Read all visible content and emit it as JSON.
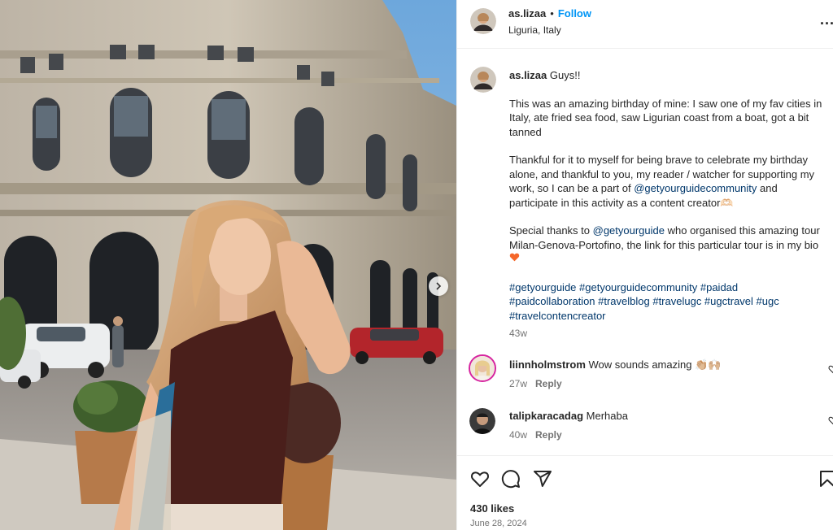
{
  "post": {
    "username": "as.lizaa",
    "separator": "•",
    "follow_label": "Follow",
    "location": "Liguria, Italy",
    "more_label": "..."
  },
  "caption": {
    "username": "as.lizaa",
    "greeting": "Guys!!",
    "para1": [
      "This was an amazing birthday of mine: I saw one of my fav cities in",
      "Italy, ate fried sea food, saw Ligurian coast from a boat, got a bit",
      "tanned"
    ],
    "para2_line1": "Thankful for it to myself for being brave to celebrate my birthday",
    "para2_line2": "alone, and thankful to you, my reader / watcher for supporting my",
    "para2_line3_pre": "work, so I can be a part of ",
    "para2_line3_link": "@getyourguidecommunity",
    "para2_line3_post": " and",
    "para2_line4": "participate in this activity as a content creator🫶🏻",
    "para3_line1_pre": "Special thanks to ",
    "para3_line1_link": "@getyourguide",
    "para3_line1_post": " who organised this amazing tour",
    "para3_line2": "Milan-Genova-Portofino, the link for this particular tour is in my bio",
    "hashtags_line1": "#getyourguide #getyourguidecommunity #paidad",
    "hashtags_line2": "#paidcollaboration #travelblog #travelugc #ugctravel #ugc",
    "hashtags_line3": "#travelcontencreator",
    "time": "43w"
  },
  "comments": [
    {
      "username": "liinnholmstrom",
      "text": "Wow sounds amazing 👏🏼🙌🏼",
      "time": "27w",
      "reply": "Reply"
    },
    {
      "username": "talipkaracadag",
      "text": "Merhaba",
      "time": "40w",
      "reply": "Reply"
    }
  ],
  "actions": {
    "likes": "430 likes",
    "date": "June 28, 2024"
  },
  "colors": {
    "follow": "#0095f6",
    "link": "#00376b",
    "heart_emoji": "#f5672a"
  },
  "icons": [
    "more-icon",
    "chevron-right-icon",
    "heart-icon",
    "comment-icon",
    "share-icon",
    "bookmark-icon"
  ]
}
